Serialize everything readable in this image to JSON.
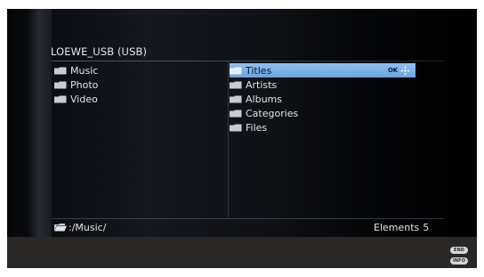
{
  "source": {
    "title": "LOEWE_USB (USB)"
  },
  "left_list": {
    "items": [
      {
        "label": "Music",
        "icon": "folder-icon"
      },
      {
        "label": "Photo",
        "icon": "folder-icon"
      },
      {
        "label": "Video",
        "icon": "folder-icon"
      }
    ]
  },
  "right_list": {
    "items": [
      {
        "label": "Titles",
        "icon": "folder-icon",
        "selected": true,
        "ok_hint": "OK"
      },
      {
        "label": "Artists",
        "icon": "folder-icon"
      },
      {
        "label": "Albums",
        "icon": "folder-icon"
      },
      {
        "label": "Categories",
        "icon": "folder-icon"
      },
      {
        "label": "Files",
        "icon": "folder-icon"
      }
    ]
  },
  "status": {
    "path": ":/Music/",
    "elements_label": "Elements",
    "elements_count": "5"
  },
  "remote_buttons": {
    "end": "END",
    "info": "INFO"
  },
  "colors": {
    "selection": "#7ab3e8",
    "text": "#e2e4ea",
    "bottom_band": "#2a2727",
    "folder": "#c8ccd4"
  }
}
